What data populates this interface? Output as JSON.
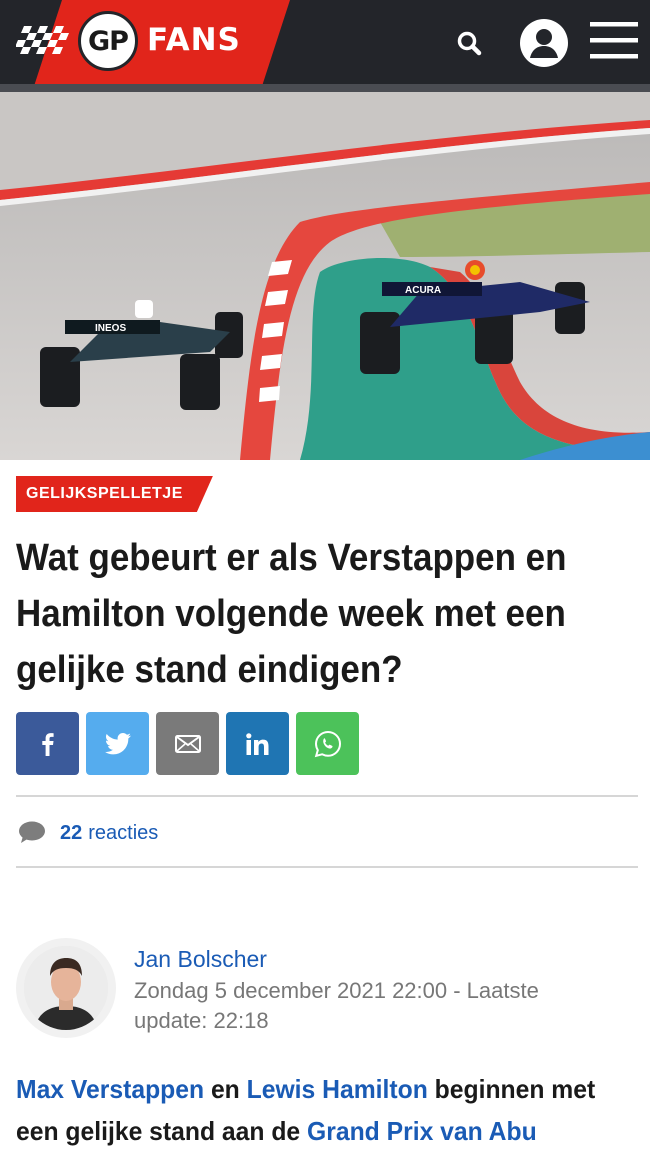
{
  "header": {
    "logo_gp": "GP",
    "logo_fans": "FANS",
    "search_icon": "search-icon",
    "user_icon": "user-icon",
    "menu_icon": "hamburger-menu-icon"
  },
  "hero": {
    "alt": "Formula 1 cars of Hamilton and Verstappen racing on track",
    "sponsor_left": "INEOS",
    "sponsor_right": "ACURA"
  },
  "article": {
    "category": "GELIJKSPELLETJE",
    "title": "Wat gebeurt er als Verstappen en Hamilton volgende week met een gelijke stand eindigen?",
    "share_buttons": [
      {
        "name": "facebook",
        "icon": "facebook-icon",
        "color": "#3b5a9a"
      },
      {
        "name": "twitter",
        "icon": "twitter-icon",
        "color": "#55acee"
      },
      {
        "name": "email",
        "icon": "email-icon",
        "color": "#7a7a7a"
      },
      {
        "name": "linkedin",
        "icon": "linkedin-icon",
        "color": "#1f75b3"
      },
      {
        "name": "whatsapp",
        "icon": "whatsapp-icon",
        "color": "#4cc25a"
      }
    ],
    "comments_count": "22",
    "comments_label": "reacties",
    "author": "Jan Bolscher",
    "date": "Zondag 5 december 2021 22:00 - Laatste update: 22:18",
    "body": {
      "link1": "Max Verstappen",
      "text1": " en ",
      "link2": "Lewis Hamilton",
      "text2": " beginnen met een gelijke stand aan de ",
      "link3": "Grand Prix van Abu"
    }
  },
  "colors": {
    "header_bg": "#23252a",
    "brand_red": "#e1251b",
    "link_blue": "#1a5bb5"
  }
}
